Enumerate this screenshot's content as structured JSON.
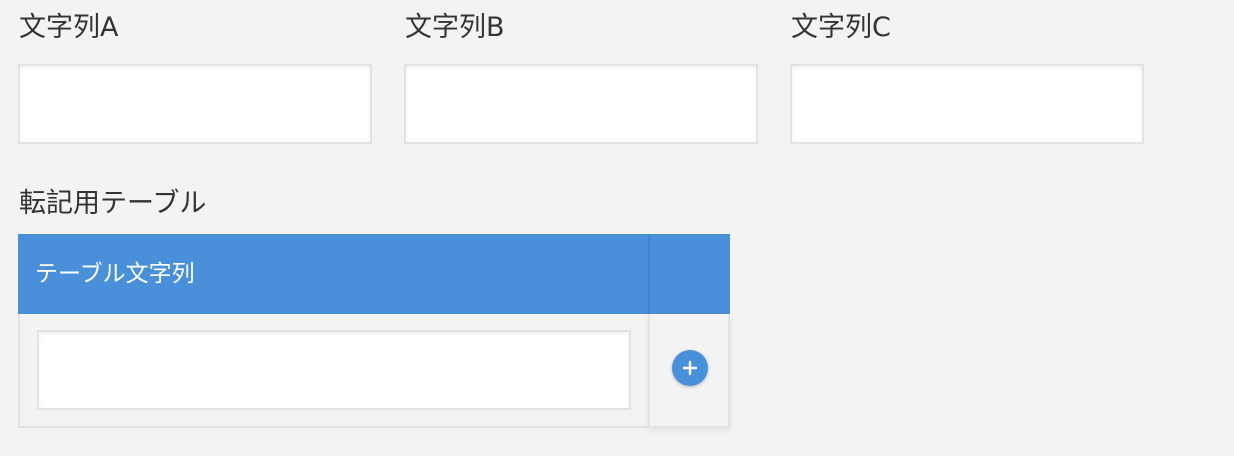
{
  "fields": [
    {
      "label": "文字列A",
      "value": "",
      "placeholder": ""
    },
    {
      "label": "文字列B",
      "value": "",
      "placeholder": ""
    },
    {
      "label": "文字列C",
      "value": "",
      "placeholder": ""
    }
  ],
  "table": {
    "label": "転記用テーブル",
    "columns": [
      {
        "header": "テーブル文字列"
      }
    ],
    "rows": [
      {
        "cells": [
          {
            "value": ""
          }
        ]
      }
    ],
    "add_button_icon": "plus-circle-icon"
  },
  "colors": {
    "background": "#f3f3f3",
    "accent": "#4a8fd9",
    "border": "#e3e3e3",
    "text": "#333333"
  }
}
